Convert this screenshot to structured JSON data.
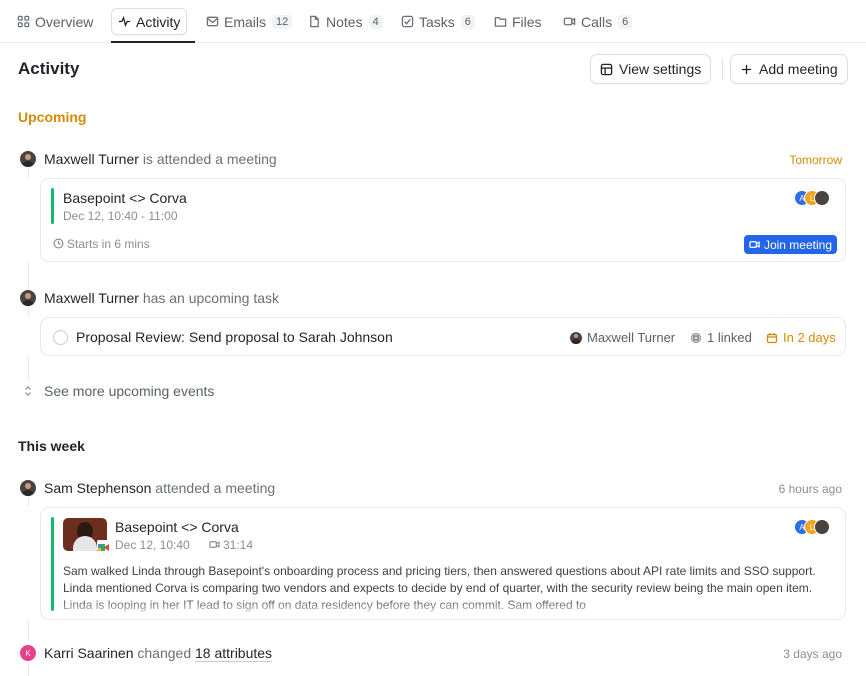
{
  "tabs": [
    {
      "label": "Overview",
      "icon": "overview-icon"
    },
    {
      "label": "Activity",
      "icon": "activity-icon",
      "active": true
    },
    {
      "label": "Emails",
      "count": "12",
      "icon": "mail-icon"
    },
    {
      "label": "Notes",
      "count": "4",
      "icon": "note-icon"
    },
    {
      "label": "Tasks",
      "count": "6",
      "icon": "task-icon"
    },
    {
      "label": "Files",
      "icon": "folder-icon"
    },
    {
      "label": "Calls",
      "count": "6",
      "icon": "video-icon"
    }
  ],
  "header": {
    "title": "Activity",
    "view_settings": "View settings",
    "add_meeting": "Add meeting"
  },
  "upcoming": {
    "title": "Upcoming",
    "meeting_event": {
      "who": "Maxwell Turner",
      "action": "is attended a meeting",
      "time": "Tomorrow",
      "card": {
        "title": "Basepoint <> Corva",
        "datetime": "Dec 12, 10:40 - 11:00",
        "starts": "Starts in 6 mins",
        "join": "Join meeting"
      }
    },
    "task_event": {
      "who": "Maxwell Turner",
      "action": "has an upcoming task",
      "card": {
        "title": "Proposal Review: Send proposal to Sarah Johnson",
        "assignee": "Maxwell Turner",
        "linked": "1 linked",
        "due": "In 2 days"
      }
    },
    "see_more": "See more upcoming events"
  },
  "this_week": {
    "title": "This week",
    "call_event": {
      "who": "Sam Stephenson",
      "action": "attended a meeting",
      "time": "6 hours ago",
      "card": {
        "title": "Basepoint <> Corva",
        "datetime": "Dec 12, 10:40",
        "duration": "31:14",
        "summary": "Sam walked Linda through Basepoint's onboarding process and pricing tiers, then answered questions about API rate limits and SSO support. Linda mentioned Corva is comparing two vendors and expects to decide by end of quarter, with the security review being the main open item. Linda is looping in her IT lead to sign off on data residency before they can commit. Sam offered to"
      }
    },
    "attr_event": {
      "who": "Karri Saarinen",
      "initial": "K",
      "action": "changed",
      "attributes": "18 attributes",
      "time": "3 days ago"
    }
  },
  "participants": [
    {
      "initial": "A",
      "color": "#2f6fe4"
    },
    {
      "initial": "L",
      "color": "#f2a51c"
    }
  ],
  "colors": {
    "accent_orange": "#d38a06",
    "join_blue": "#2366e8",
    "meeting_green": "#17b86a",
    "karri_pink": "#e83e8c"
  }
}
